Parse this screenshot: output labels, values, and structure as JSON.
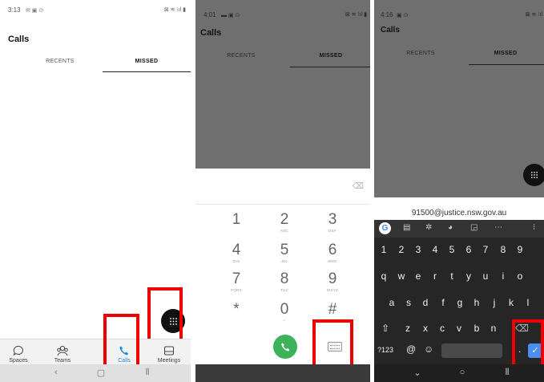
{
  "panel1": {
    "status_time": "3:13",
    "title": "Calls",
    "tabs": [
      {
        "label": "RECENTS"
      },
      {
        "label": "MISSED"
      }
    ],
    "bottom_nav": [
      {
        "label": "Spaces",
        "icon": "spaces-icon"
      },
      {
        "label": "Teams",
        "icon": "teams-icon"
      },
      {
        "label": "Calls",
        "icon": "phone-icon"
      },
      {
        "label": "Meetings",
        "icon": "meetings-icon"
      }
    ],
    "active_tab": "Calls",
    "accent_color": "#1a8fd6"
  },
  "panel2": {
    "status_time": "4:01",
    "title": "Calls",
    "tabs": [
      {
        "label": "RECENTS"
      },
      {
        "label": "MISSED"
      }
    ],
    "keys": [
      {
        "digit": "1",
        "letters": ""
      },
      {
        "digit": "2",
        "letters": "ABC"
      },
      {
        "digit": "3",
        "letters": "DEF"
      },
      {
        "digit": "4",
        "letters": "GHI"
      },
      {
        "digit": "5",
        "letters": "JKL"
      },
      {
        "digit": "6",
        "letters": "MNO"
      },
      {
        "digit": "7",
        "letters": "PQRS"
      },
      {
        "digit": "8",
        "letters": "TUV"
      },
      {
        "digit": "9",
        "letters": "WXYZ"
      },
      {
        "digit": "*",
        "letters": ""
      },
      {
        "digit": "0",
        "letters": "+"
      },
      {
        "digit": "#",
        "letters": ""
      }
    ],
    "call_button_color": "#3cb35a"
  },
  "panel3": {
    "status_time": "4:16",
    "title": "Calls",
    "tabs": [
      {
        "label": "RECENTS"
      },
      {
        "label": "MISSED"
      }
    ],
    "dial_input_value": "91500@justice.nsw.gov.au",
    "kb_number_row": [
      "1",
      "2",
      "3",
      "4",
      "5",
      "6",
      "7",
      "8",
      "9"
    ],
    "kb_row1": [
      "q",
      "w",
      "e",
      "r",
      "t",
      "y",
      "u",
      "i",
      "o"
    ],
    "kb_row2": [
      "a",
      "s",
      "d",
      "f",
      "g",
      "h",
      "j",
      "k",
      "l"
    ],
    "kb_row3": [
      "z",
      "x",
      "c",
      "v",
      "b",
      "n"
    ],
    "kb_symbols_label": "?123",
    "kb_at": "@",
    "kb_period": ".",
    "enter_color": "#4a8ef0"
  }
}
